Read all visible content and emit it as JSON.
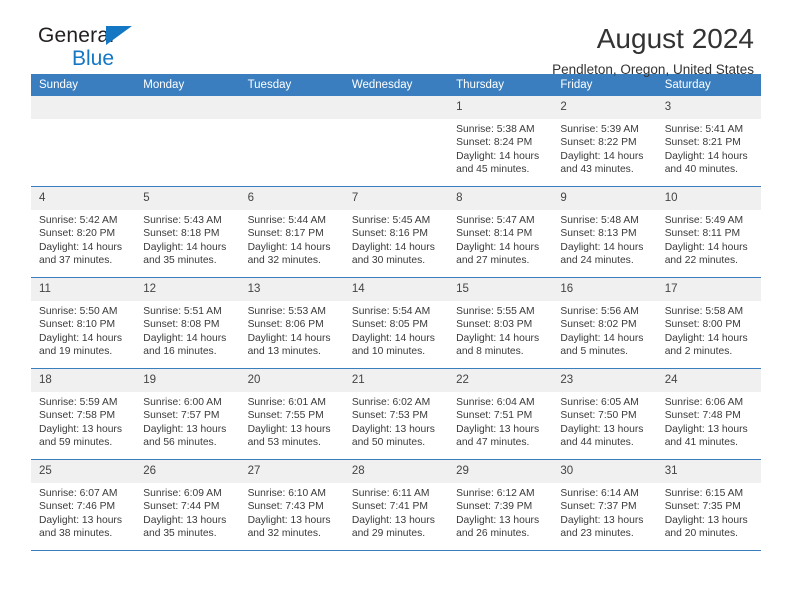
{
  "brand": {
    "name_part1": "General",
    "name_part2": "Blue",
    "triangle_color": "#1477c4"
  },
  "header": {
    "title": "August 2024",
    "location": "Pendleton, Oregon, United States"
  },
  "theme": {
    "header_blue": "#3a7ebf",
    "daynum_band": "#f0f0f0",
    "text": "#3a3a3a"
  },
  "weekdays": [
    "Sunday",
    "Monday",
    "Tuesday",
    "Wednesday",
    "Thursday",
    "Friday",
    "Saturday"
  ],
  "weeks": [
    [
      {
        "day": "",
        "sunrise": "",
        "sunset": "",
        "daylight": ""
      },
      {
        "day": "",
        "sunrise": "",
        "sunset": "",
        "daylight": ""
      },
      {
        "day": "",
        "sunrise": "",
        "sunset": "",
        "daylight": ""
      },
      {
        "day": "",
        "sunrise": "",
        "sunset": "",
        "daylight": ""
      },
      {
        "day": "1",
        "sunrise": "Sunrise: 5:38 AM",
        "sunset": "Sunset: 8:24 PM",
        "daylight": "Daylight: 14 hours and 45 minutes."
      },
      {
        "day": "2",
        "sunrise": "Sunrise: 5:39 AM",
        "sunset": "Sunset: 8:22 PM",
        "daylight": "Daylight: 14 hours and 43 minutes."
      },
      {
        "day": "3",
        "sunrise": "Sunrise: 5:41 AM",
        "sunset": "Sunset: 8:21 PM",
        "daylight": "Daylight: 14 hours and 40 minutes."
      }
    ],
    [
      {
        "day": "4",
        "sunrise": "Sunrise: 5:42 AM",
        "sunset": "Sunset: 8:20 PM",
        "daylight": "Daylight: 14 hours and 37 minutes."
      },
      {
        "day": "5",
        "sunrise": "Sunrise: 5:43 AM",
        "sunset": "Sunset: 8:18 PM",
        "daylight": "Daylight: 14 hours and 35 minutes."
      },
      {
        "day": "6",
        "sunrise": "Sunrise: 5:44 AM",
        "sunset": "Sunset: 8:17 PM",
        "daylight": "Daylight: 14 hours and 32 minutes."
      },
      {
        "day": "7",
        "sunrise": "Sunrise: 5:45 AM",
        "sunset": "Sunset: 8:16 PM",
        "daylight": "Daylight: 14 hours and 30 minutes."
      },
      {
        "day": "8",
        "sunrise": "Sunrise: 5:47 AM",
        "sunset": "Sunset: 8:14 PM",
        "daylight": "Daylight: 14 hours and 27 minutes."
      },
      {
        "day": "9",
        "sunrise": "Sunrise: 5:48 AM",
        "sunset": "Sunset: 8:13 PM",
        "daylight": "Daylight: 14 hours and 24 minutes."
      },
      {
        "day": "10",
        "sunrise": "Sunrise: 5:49 AM",
        "sunset": "Sunset: 8:11 PM",
        "daylight": "Daylight: 14 hours and 22 minutes."
      }
    ],
    [
      {
        "day": "11",
        "sunrise": "Sunrise: 5:50 AM",
        "sunset": "Sunset: 8:10 PM",
        "daylight": "Daylight: 14 hours and 19 minutes."
      },
      {
        "day": "12",
        "sunrise": "Sunrise: 5:51 AM",
        "sunset": "Sunset: 8:08 PM",
        "daylight": "Daylight: 14 hours and 16 minutes."
      },
      {
        "day": "13",
        "sunrise": "Sunrise: 5:53 AM",
        "sunset": "Sunset: 8:06 PM",
        "daylight": "Daylight: 14 hours and 13 minutes."
      },
      {
        "day": "14",
        "sunrise": "Sunrise: 5:54 AM",
        "sunset": "Sunset: 8:05 PM",
        "daylight": "Daylight: 14 hours and 10 minutes."
      },
      {
        "day": "15",
        "sunrise": "Sunrise: 5:55 AM",
        "sunset": "Sunset: 8:03 PM",
        "daylight": "Daylight: 14 hours and 8 minutes."
      },
      {
        "day": "16",
        "sunrise": "Sunrise: 5:56 AM",
        "sunset": "Sunset: 8:02 PM",
        "daylight": "Daylight: 14 hours and 5 minutes."
      },
      {
        "day": "17",
        "sunrise": "Sunrise: 5:58 AM",
        "sunset": "Sunset: 8:00 PM",
        "daylight": "Daylight: 14 hours and 2 minutes."
      }
    ],
    [
      {
        "day": "18",
        "sunrise": "Sunrise: 5:59 AM",
        "sunset": "Sunset: 7:58 PM",
        "daylight": "Daylight: 13 hours and 59 minutes."
      },
      {
        "day": "19",
        "sunrise": "Sunrise: 6:00 AM",
        "sunset": "Sunset: 7:57 PM",
        "daylight": "Daylight: 13 hours and 56 minutes."
      },
      {
        "day": "20",
        "sunrise": "Sunrise: 6:01 AM",
        "sunset": "Sunset: 7:55 PM",
        "daylight": "Daylight: 13 hours and 53 minutes."
      },
      {
        "day": "21",
        "sunrise": "Sunrise: 6:02 AM",
        "sunset": "Sunset: 7:53 PM",
        "daylight": "Daylight: 13 hours and 50 minutes."
      },
      {
        "day": "22",
        "sunrise": "Sunrise: 6:04 AM",
        "sunset": "Sunset: 7:51 PM",
        "daylight": "Daylight: 13 hours and 47 minutes."
      },
      {
        "day": "23",
        "sunrise": "Sunrise: 6:05 AM",
        "sunset": "Sunset: 7:50 PM",
        "daylight": "Daylight: 13 hours and 44 minutes."
      },
      {
        "day": "24",
        "sunrise": "Sunrise: 6:06 AM",
        "sunset": "Sunset: 7:48 PM",
        "daylight": "Daylight: 13 hours and 41 minutes."
      }
    ],
    [
      {
        "day": "25",
        "sunrise": "Sunrise: 6:07 AM",
        "sunset": "Sunset: 7:46 PM",
        "daylight": "Daylight: 13 hours and 38 minutes."
      },
      {
        "day": "26",
        "sunrise": "Sunrise: 6:09 AM",
        "sunset": "Sunset: 7:44 PM",
        "daylight": "Daylight: 13 hours and 35 minutes."
      },
      {
        "day": "27",
        "sunrise": "Sunrise: 6:10 AM",
        "sunset": "Sunset: 7:43 PM",
        "daylight": "Daylight: 13 hours and 32 minutes."
      },
      {
        "day": "28",
        "sunrise": "Sunrise: 6:11 AM",
        "sunset": "Sunset: 7:41 PM",
        "daylight": "Daylight: 13 hours and 29 minutes."
      },
      {
        "day": "29",
        "sunrise": "Sunrise: 6:12 AM",
        "sunset": "Sunset: 7:39 PM",
        "daylight": "Daylight: 13 hours and 26 minutes."
      },
      {
        "day": "30",
        "sunrise": "Sunrise: 6:14 AM",
        "sunset": "Sunset: 7:37 PM",
        "daylight": "Daylight: 13 hours and 23 minutes."
      },
      {
        "day": "31",
        "sunrise": "Sunrise: 6:15 AM",
        "sunset": "Sunset: 7:35 PM",
        "daylight": "Daylight: 13 hours and 20 minutes."
      }
    ]
  ]
}
